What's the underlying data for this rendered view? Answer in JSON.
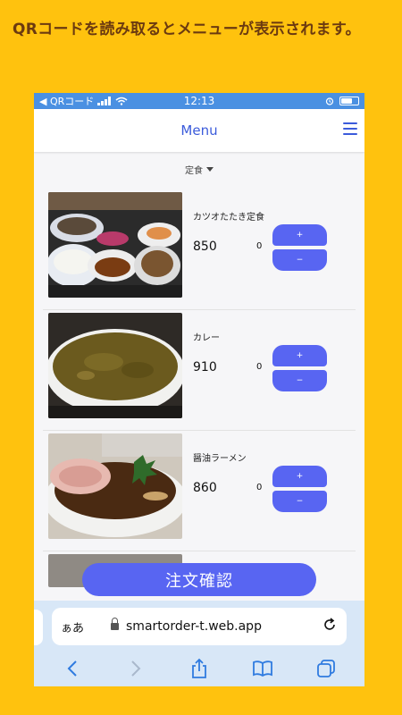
{
  "headline": "QRコードを読み取るとメニューが表示されます。",
  "status_bar": {
    "back_label": "◀ QRコード",
    "time": "12:13"
  },
  "navbar": {
    "title": "Menu",
    "menu_icon": "hamburger-icon"
  },
  "category": {
    "selected": "定食"
  },
  "items": [
    {
      "name": "カツオたたき定食",
      "price": "850",
      "qty": "0",
      "plus": "+",
      "minus": "−"
    },
    {
      "name": "カレー",
      "price": "910",
      "qty": "0",
      "plus": "+",
      "minus": "−"
    },
    {
      "name": "醤油ラーメン",
      "price": "860",
      "qty": "0",
      "plus": "+",
      "minus": "−"
    }
  ],
  "order_button": "注文確認",
  "browser": {
    "aa_label": "ぁあ",
    "url": "smartorder-t.web.app",
    "toolbar_icons": [
      "back-icon",
      "forward-icon",
      "share-icon",
      "bookmarks-icon",
      "tabs-icon"
    ]
  },
  "colors": {
    "background": "#FFC20E",
    "accent": "#5865F2",
    "nav_title": "#3B5BDB",
    "status_bar": "#4A90E2"
  }
}
